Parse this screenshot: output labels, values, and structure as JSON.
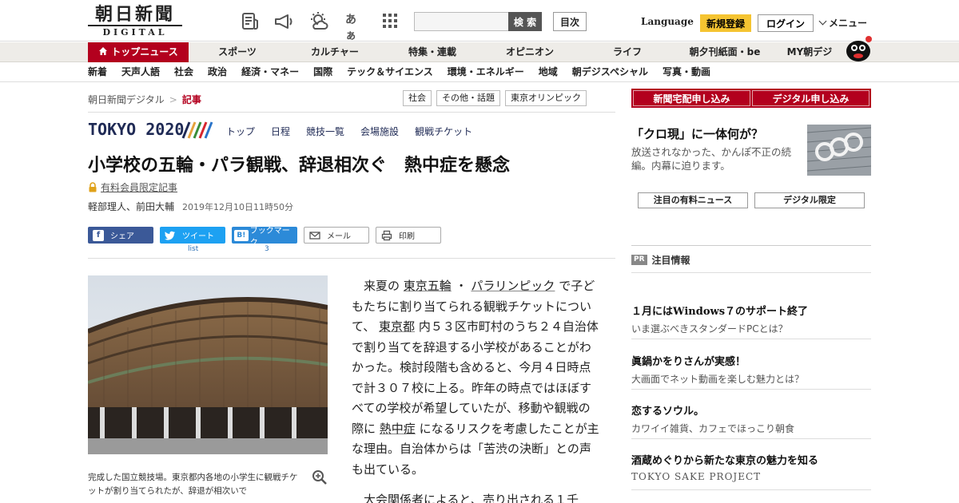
{
  "header": {
    "logo_main": "朝日新聞",
    "logo_sub": "DIGITAL",
    "search_placeholder": "",
    "search_label": "検 索",
    "toc_label": "目次",
    "language_label": "Language",
    "register_label": "新規登録",
    "login_label": "ログイン",
    "menu_label": "メニュー",
    "font_icon_label": "あぁ"
  },
  "nav_primary": [
    "トップニュース",
    "スポーツ",
    "カルチャー",
    "特集・連載",
    "オピニオン",
    "ライフ",
    "朝夕刊紙面・be",
    "MY朝デジ"
  ],
  "nav_secondary": [
    "新着",
    "天声人語",
    "社会",
    "政治",
    "経済・マネー",
    "国際",
    "テック＆サイエンス",
    "環境・エネルギー",
    "地域",
    "朝デジスペシャル",
    "写真・動画"
  ],
  "breadcrumb": {
    "home": "朝日新聞デジタル",
    "sep": ">",
    "current": "記事"
  },
  "tags": [
    "社会",
    "その他・話題",
    "東京オリンピック"
  ],
  "tokyo2020": {
    "logo": "TOKYO 2020",
    "links": [
      "トップ",
      "日程",
      "競技一覧",
      "会場施設",
      "観戦チケット"
    ]
  },
  "article": {
    "headline": "小学校の五輪・パラ観戦、辞退相次ぐ　熱中症を懸念",
    "members_label": "有料会員限定記事",
    "authors": "軽部理人、前田大輔",
    "date": "2019年12月10日11時50分",
    "share": {
      "facebook": "シェア",
      "twitter": "ツイート",
      "hatena": "ブックマーク",
      "hatena_icon": "B!",
      "mail": "メール",
      "print": "印刷",
      "twitter_count": "list",
      "hatena_count": "3"
    },
    "caption": "完成した国立競技場。東京都内各地の小学生に観戦チケットが割り当てられたが、辞退が相次いで",
    "body_1a": "来夏の",
    "kw_1": "東京五輪",
    "body_1b": "・",
    "kw_2": "パラリンピック",
    "body_1c": "で子どもたちに割り当てられる観戦チケットについて、",
    "kw_3": "東京都",
    "body_1d": "内５３区市町村のうち２４自治体で割り当てを辞退する小学校があることがわかった。検討段階も含めると、今月４日時点で計３０７校に上る。昨年の時点ではほぼすべての学校が希望していたが、移動や観戦の際に",
    "kw_4": "熱中症",
    "body_1e": "になるリスクを考慮したことが主な理由。自治体からは「苦渋の決断」との声も出ている。",
    "body_2": "大会関係者によると、売り出される１千"
  },
  "sidebar": {
    "sub_home": "新聞宅配申し込み",
    "sub_digital": "デジタル申し込み",
    "promo_title": "「クロ現」に一体何が？",
    "promo_desc": "放送されなかった、かんぽ不正の続編。内幕に迫ります。",
    "tab_paid": "注目の有料ニュース",
    "tab_digital": "デジタル限定",
    "pr_badge": "PR",
    "pr_title": "注目情報",
    "pr_items": [
      {
        "title": "１月にはWindows７のサポート終了",
        "desc": "いま選ぶべきスタンダードPCとは？"
      },
      {
        "title": "眞鍋かをりさんが実感！",
        "desc": "大画面でネット動画を楽しむ魅力とは？"
      },
      {
        "title": "恋するソウル。",
        "desc": "カワイイ雑貨、カフェでほっこり朝食"
      },
      {
        "title": "酒蔵めぐりから新たな東京の魅力を知る",
        "desc": "TOKYO SAKE PROJECT"
      }
    ]
  },
  "colors": {
    "brand_red": "#b3001e",
    "register_yellow": "#f5c431",
    "facebook": "#3b5998",
    "twitter": "#1da1f2",
    "hatena": "#2c8ad8",
    "tokyo_navy": "#1f2a55"
  }
}
